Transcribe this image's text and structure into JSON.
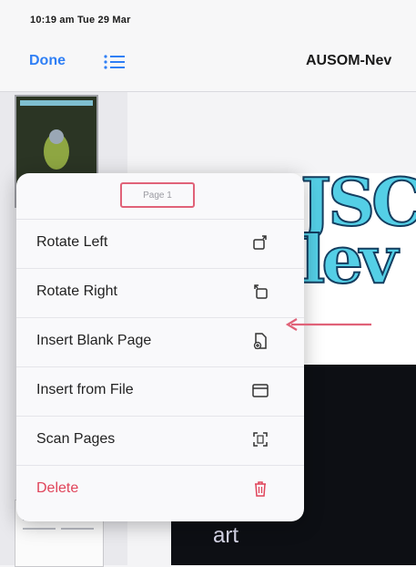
{
  "status_bar": {
    "time": "10:19 am  Tue 29 Mar"
  },
  "nav": {
    "done_label": "Done",
    "title": "AUSOM-Nev"
  },
  "document": {
    "banner_line1": "JSC",
    "banner_line2": "lev",
    "art_text": "art"
  },
  "context_menu": {
    "page_label": "Page 1",
    "items": [
      {
        "label": "Rotate Left",
        "icon": "rotate-left-icon"
      },
      {
        "label": "Rotate Right",
        "icon": "rotate-right-icon"
      },
      {
        "label": "Insert Blank Page",
        "icon": "insert-blank-page-icon"
      },
      {
        "label": "Insert from File",
        "icon": "insert-from-file-icon"
      },
      {
        "label": "Scan Pages",
        "icon": "scan-pages-icon"
      },
      {
        "label": "Delete",
        "icon": "trash-icon"
      }
    ]
  },
  "colors": {
    "accent": "#2f7ff5",
    "destructive": "#e0445a",
    "annotation": "#e06278"
  }
}
